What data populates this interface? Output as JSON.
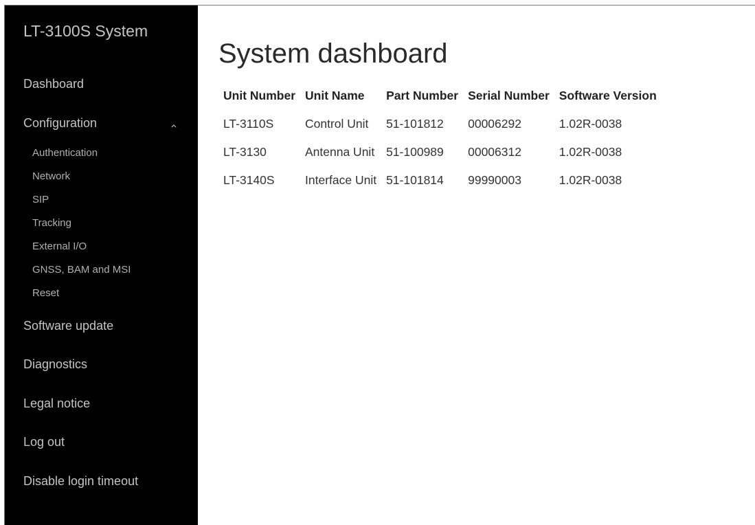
{
  "sidebar": {
    "brand": "LT-3100S System",
    "items": [
      {
        "label": "Dashboard"
      },
      {
        "label": "Configuration"
      },
      {
        "label": "Software update"
      },
      {
        "label": "Diagnostics"
      },
      {
        "label": "Legal notice"
      },
      {
        "label": "Log out"
      },
      {
        "label": "Disable login timeout"
      }
    ],
    "config_sub": [
      {
        "label": "Authentication"
      },
      {
        "label": "Network"
      },
      {
        "label": "SIP"
      },
      {
        "label": "Tracking"
      },
      {
        "label": "External I/O"
      },
      {
        "label": "GNSS, BAM and MSI"
      },
      {
        "label": "Reset"
      }
    ],
    "config_expanded": true
  },
  "main": {
    "title": "System dashboard",
    "table": {
      "headers": [
        "Unit Number",
        "Unit Name",
        "Part Number",
        "Serial Number",
        "Software Version"
      ],
      "rows": [
        [
          "LT-3110S",
          "Control Unit",
          "51-101812",
          "00006292",
          "1.02R-0038"
        ],
        [
          "LT-3130",
          "Antenna Unit",
          "51-100989",
          "00006312",
          "1.02R-0038"
        ],
        [
          "LT-3140S",
          "Interface Unit",
          "51-101814",
          "99990003",
          "1.02R-0038"
        ]
      ]
    }
  },
  "colors": {
    "sidebar_bg": "#000000",
    "sidebar_text": "#c4c4c4",
    "main_bg": "#ffffff"
  }
}
